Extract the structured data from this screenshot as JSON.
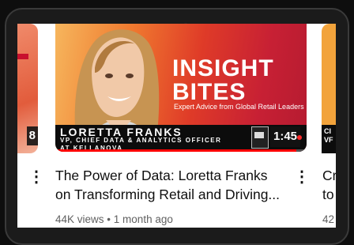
{
  "main_video": {
    "thumb_title_line1": "INSIGHT",
    "thumb_title_line2": "BITES",
    "thumb_tagline": "Expert Advice from Global Retail Leaders",
    "speaker_name": "LORETTA FRANKS",
    "speaker_role": "VP, CHIEF DATA & ANALYTICS OFFICER",
    "speaker_company": "AT KELLANOVA",
    "duration": "1:45",
    "title_line1": "The Power of Data: Loretta Franks",
    "title_line2": "on Transforming Retail and Driving...",
    "views": "44K views",
    "separator": "•",
    "age": "1 month ago",
    "more_icon": "⋮",
    "watch_progress": 0.96
  },
  "left_video": {
    "duration": "8",
    "more_icon": "⋮"
  },
  "right_video": {
    "band_line1": "CI",
    "band_line2": "VF",
    "title_line1": "Cr",
    "title_line2": "to",
    "meta": "42"
  },
  "colors": {
    "accent_red": "#ff0000",
    "thumb_orange": "#f07a2f",
    "thumb_red": "#c72034"
  }
}
